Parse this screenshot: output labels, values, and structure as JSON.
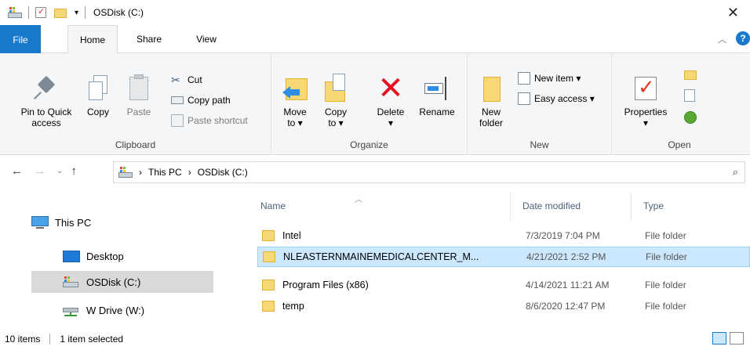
{
  "window": {
    "title": "OSDisk (C:)"
  },
  "tabs": {
    "file": "File",
    "home": "Home",
    "share": "Share",
    "view": "View"
  },
  "ribbon": {
    "clipboard": {
      "label": "Clipboard",
      "pin_line1": "Pin to Quick",
      "pin_line2": "access",
      "copy": "Copy",
      "paste": "Paste",
      "cut": "Cut",
      "copy_path": "Copy path",
      "paste_shortcut": "Paste shortcut"
    },
    "organize": {
      "label": "Organize",
      "move_line1": "Move",
      "move_line2": "to ▾",
      "copy_line1": "Copy",
      "copy_line2": "to ▾",
      "delete_line1": "Delete",
      "delete_line2": "▾",
      "rename": "Rename"
    },
    "new": {
      "label": "New",
      "folder_line1": "New",
      "folder_line2": "folder",
      "new_item": "New item ▾",
      "easy_access": "Easy access ▾"
    },
    "open": {
      "label": "Open",
      "properties": "Properties",
      "properties_caret": "▾"
    }
  },
  "address": {
    "this_pc": "This PC",
    "drive": "OSDisk (C:)",
    "sep": "›"
  },
  "navpane": {
    "items": [
      {
        "label": "This PC"
      },
      {
        "label": "Desktop"
      },
      {
        "label": "OSDisk (C:)"
      },
      {
        "label": "W Drive (W:)"
      }
    ]
  },
  "filelist": {
    "columns": {
      "name": "Name",
      "date": "Date modified",
      "type": "Type"
    },
    "rows": [
      {
        "name": "Intel",
        "date": "7/3/2019 7:04 PM",
        "type": "File folder"
      },
      {
        "name": "NLEASTERNMAINEMEDICALCENTER_M...",
        "date": "4/21/2021 2:52 PM",
        "type": "File folder"
      },
      {
        "name": "Program Files (x86)",
        "date": "4/14/2021 11:21 AM",
        "type": "File folder"
      },
      {
        "name": "temp",
        "date": "8/6/2020 12:47 PM",
        "type": "File folder"
      }
    ]
  },
  "status": {
    "items": "10 items",
    "selected": "1 item selected"
  },
  "colors": {
    "accent": "#1979ca",
    "selection": "#cce8ff",
    "folder": "#f8d775"
  }
}
